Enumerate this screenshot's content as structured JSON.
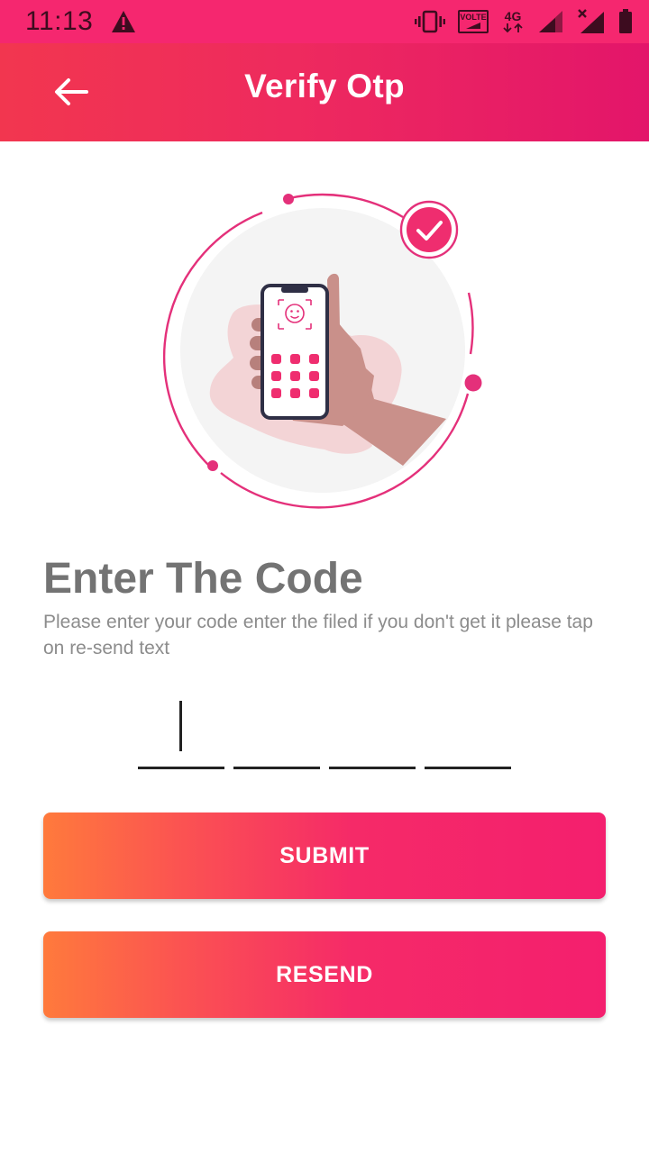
{
  "status_bar": {
    "time": "11:13",
    "volte_label": "VOLTE",
    "network_label": "4G",
    "icons": [
      "warning-icon",
      "vibrate-icon",
      "volte-icon",
      "network-4g-icon",
      "signal-icon",
      "signal-no-service-icon",
      "battery-icon"
    ]
  },
  "app_bar": {
    "title": "Verify Otp",
    "back_icon": "arrow-left-icon"
  },
  "illustration": {
    "icon": "phone-in-hand-verified-illustration",
    "accent_color": "#f0306f"
  },
  "content": {
    "heading": "Enter The Code",
    "description": "Please enter your code enter the filed if you don't get it please tap on re-send text"
  },
  "otp": {
    "digits": [
      "",
      "",
      "",
      ""
    ],
    "focused_index": 0
  },
  "actions": {
    "submit_label": "SUBMIT",
    "resend_label": "RESEND"
  },
  "colors": {
    "status_bar": "#f5276f",
    "app_bar_start": "#f2364f",
    "app_bar_end": "#e3156a",
    "button_start": "#ff7a3c",
    "button_end": "#f41f6e",
    "heading_text": "#737373",
    "body_text": "#8c8c8c"
  }
}
